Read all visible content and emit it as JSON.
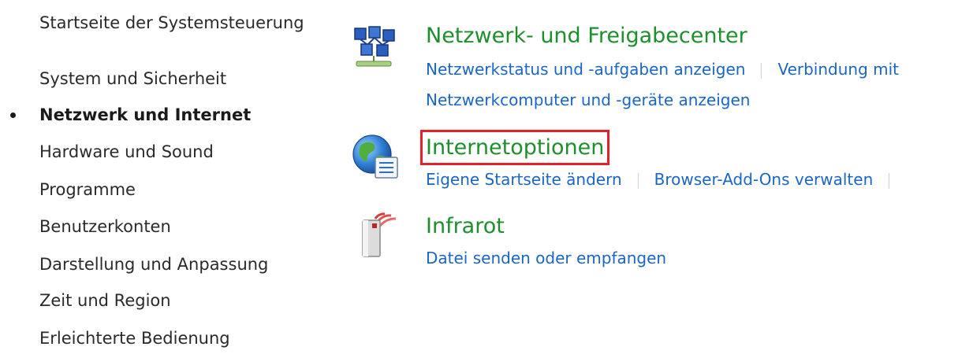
{
  "sidebar": {
    "items": [
      {
        "label": "Startseite der Systemsteuerung"
      },
      {
        "label": "System und Sicherheit"
      },
      {
        "label": "Netzwerk und Internet",
        "active": true
      },
      {
        "label": "Hardware und Sound"
      },
      {
        "label": "Programme"
      },
      {
        "label": "Benutzerkonten"
      },
      {
        "label": "Darstellung und Anpassung"
      },
      {
        "label": "Zeit und Region"
      },
      {
        "label": "Erleichterte Bedienung"
      }
    ]
  },
  "main": {
    "categories": [
      {
        "title": "Netzwerk- und Freigabecenter",
        "icon": "network-icon",
        "links": [
          "Netzwerkstatus und -aufgaben anzeigen",
          "Verbindung mit",
          "Netzwerkcomputer und -geräte anzeigen"
        ]
      },
      {
        "title": "Internetoptionen",
        "icon": "globe-icon",
        "highlighted": true,
        "links": [
          "Eigene Startseite ändern",
          "Browser-Add-Ons verwalten"
        ]
      },
      {
        "title": "Infrarot",
        "icon": "infrared-icon",
        "links": [
          "Datei senden oder empfangen"
        ]
      }
    ]
  },
  "colors": {
    "category_title": "#1e8f2c",
    "link": "#1a66c7",
    "highlight_border": "#e5202a",
    "sidebar_text": "#2a2a2a"
  }
}
